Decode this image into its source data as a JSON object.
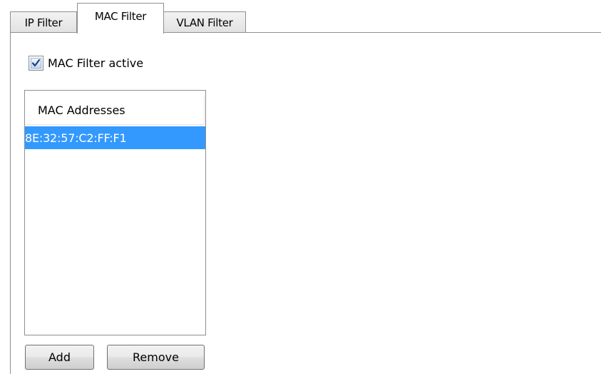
{
  "tabs": [
    {
      "label": "IP Filter",
      "active": false
    },
    {
      "label": "MAC Filter",
      "active": true
    },
    {
      "label": "VLAN Filter",
      "active": false
    }
  ],
  "mac_filter": {
    "active_checkbox": {
      "label": "MAC Filter active",
      "checked": true
    },
    "list": {
      "header": "MAC Addresses",
      "rows": [
        {
          "value": "8E:32:57:C2:FF:F1",
          "selected": true
        }
      ]
    },
    "buttons": {
      "add_label": "Add",
      "remove_label": "Remove"
    }
  },
  "colors": {
    "selection": "#3399ff",
    "checkmark": "#1c3f94",
    "border": "#8e8f8f"
  },
  "icons": {
    "checkbox": "checkmark-icon"
  }
}
